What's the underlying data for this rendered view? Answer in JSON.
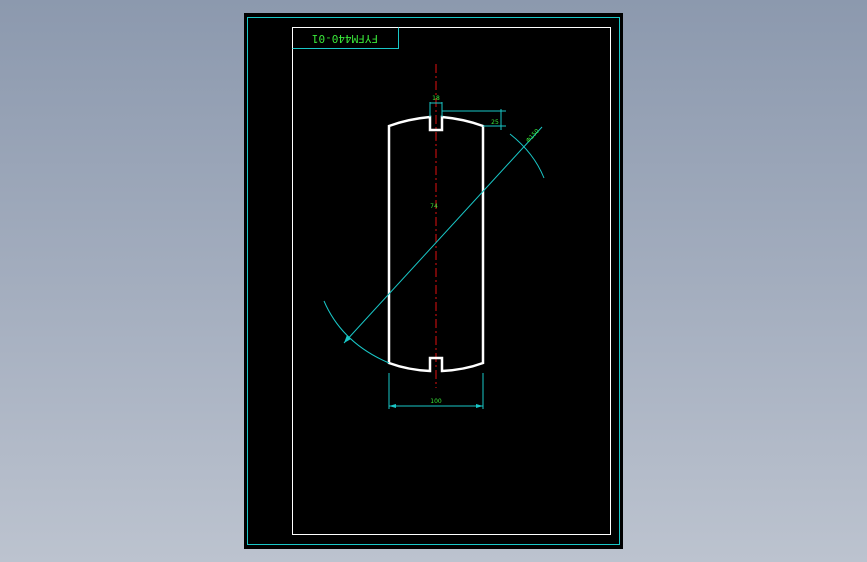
{
  "drawing": {
    "title_block_text": "FYFM440-01",
    "colors": {
      "background_outer": "#9aa5b8",
      "sheet": "#000000",
      "frame": "#19c7c7",
      "border_inner": "#ffffff",
      "outline": "#ffffff",
      "centerline": "#e01010",
      "dimension": "#19c7c7",
      "dim_text": "#39e639"
    },
    "dimensions": {
      "slot_width": "18",
      "corner_offset": "25",
      "length": "74",
      "width": "100",
      "diameter": "Φ150"
    }
  }
}
